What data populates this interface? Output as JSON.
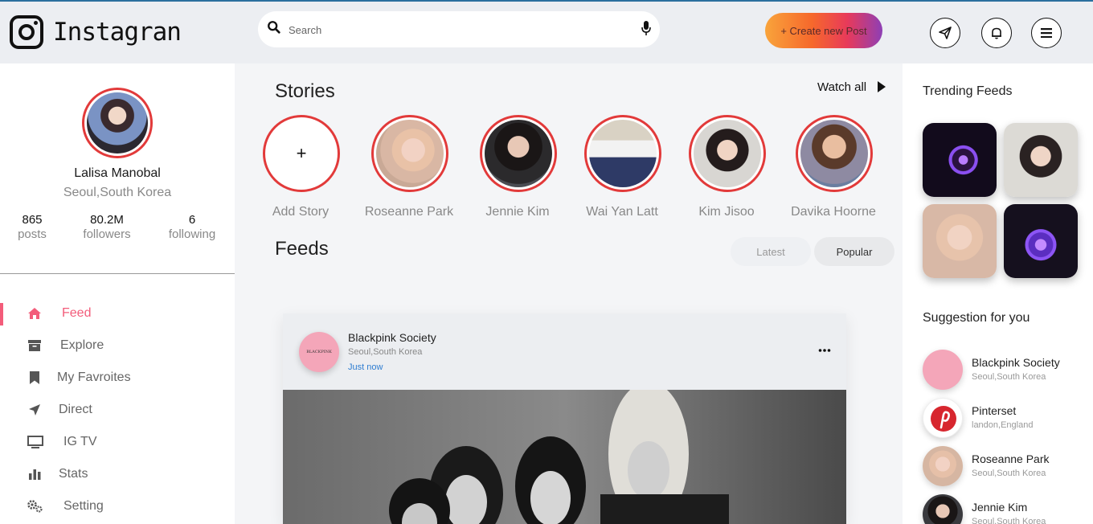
{
  "header": {
    "logo_text": "Instagran",
    "search_placeholder": "Search",
    "create_label": "+ Create new Post"
  },
  "profile": {
    "name": "Lalisa Manobal",
    "location": "Seoul,South Korea",
    "stats": [
      {
        "value": "865",
        "label": "posts"
      },
      {
        "value": "80.2M",
        "label": "followers"
      },
      {
        "value": "6",
        "label": "following"
      }
    ]
  },
  "nav": [
    {
      "label": "Feed",
      "icon": "home-icon",
      "active": true
    },
    {
      "label": "Explore",
      "icon": "archive-icon"
    },
    {
      "label": "My Favroites",
      "icon": "bookmark-icon"
    },
    {
      "label": "Direct",
      "icon": "location-arrow-icon"
    },
    {
      "label": "IG TV",
      "icon": "tv-icon"
    },
    {
      "label": "Stats",
      "icon": "bar-chart-icon"
    },
    {
      "label": "Setting",
      "icon": "gears-icon"
    }
  ],
  "stories": {
    "title": "Stories",
    "watch_all": "Watch all",
    "items": [
      {
        "name": "Add Story"
      },
      {
        "name": "Roseanne Park"
      },
      {
        "name": "Jennie Kim"
      },
      {
        "name": "Wai Yan Latt"
      },
      {
        "name": "Kim Jisoo"
      },
      {
        "name": "Davika Hoorne"
      }
    ]
  },
  "feeds": {
    "title": "Feeds",
    "tabs": [
      "Latest",
      "Popular"
    ],
    "post": {
      "author": "Blackpink Society",
      "location": "Seoul,South Korea",
      "time": "Just now",
      "avatar_text": "BLACKPINK"
    }
  },
  "trending": {
    "title": "Trending Feeds"
  },
  "suggestions": {
    "title": "Suggestion for you",
    "items": [
      {
        "name": "Blackpink Society",
        "location": "Seoul,South Korea"
      },
      {
        "name": "Pinterset",
        "location": "landon,England"
      },
      {
        "name": "Roseanne Park",
        "location": "Seoul,South Korea"
      },
      {
        "name": "Jennie Kim",
        "location": "Seoul,South Korea"
      }
    ]
  },
  "colors": {
    "accent": "#f35c7a",
    "story_ring": "#e23a3a",
    "link": "#2e7dd1"
  }
}
